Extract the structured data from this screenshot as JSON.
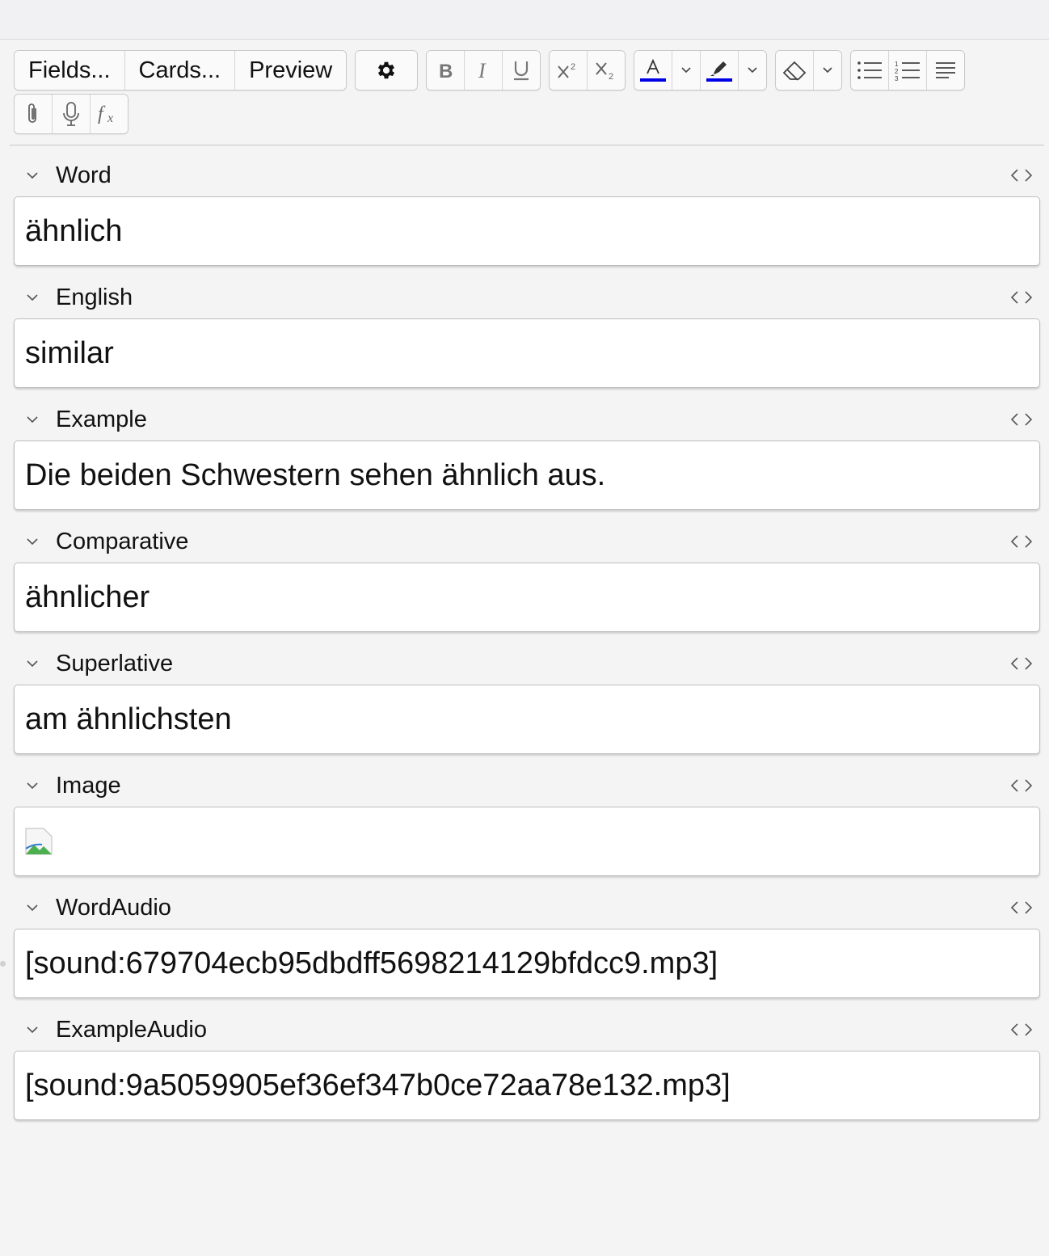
{
  "toolbar": {
    "fields_label": "Fields...",
    "cards_label": "Cards...",
    "preview_label": "Preview",
    "text_color_swatch": "#0000e6",
    "highlight_color_swatch": "#0000e6"
  },
  "fields": [
    {
      "name": "Word",
      "value": "ähnlich"
    },
    {
      "name": "English",
      "value": "similar"
    },
    {
      "name": "Example",
      "value": "Die beiden Schwestern sehen ähnlich aus."
    },
    {
      "name": "Comparative",
      "value": "ähnlicher"
    },
    {
      "name": "Superlative",
      "value": "am ähnlichsten"
    },
    {
      "name": "Image",
      "value": ""
    },
    {
      "name": "WordAudio",
      "value": "[sound:679704ecb95dbdff5698214129bfdcc9.mp3]"
    },
    {
      "name": "ExampleAudio",
      "value": "[sound:9a5059905ef36ef347b0ce72aa78e132.mp3]"
    }
  ]
}
